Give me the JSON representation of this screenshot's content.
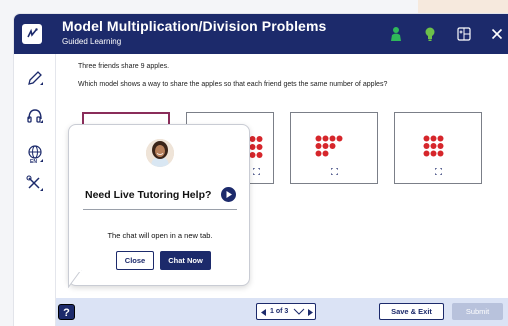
{
  "header": {
    "title": "Model Multiplication/Division Problems",
    "subtitle": "Guided Learning",
    "icons": [
      "logo-icon",
      "person-icon",
      "lightbulb-icon",
      "calculator-icon",
      "close-icon"
    ]
  },
  "sidebar": {
    "icons": [
      "pencil-tool-icon",
      "headphones-icon",
      "language-globe-icon",
      "tools-icon"
    ],
    "language_badge": "EN"
  },
  "question": {
    "line1": "Three friends share 9 apples.",
    "line2": "Which model shows a way to share the apples so that each friend gets the same number of apples?"
  },
  "popup": {
    "title": "Need Live Tutoring Help?",
    "note": "The chat will open in a new tab.",
    "close_label": "Close",
    "chat_label": "Chat Now"
  },
  "footer": {
    "help_label": "?",
    "pager_text": "1 of 3",
    "save_label": "Save & Exit",
    "submit_label": "Submit"
  },
  "colors": {
    "navy": "#1c2a6b",
    "apple_red": "#d6262b",
    "selected_border": "#8a2d5a",
    "footer_bg": "#dbe3f5",
    "person_green": "#2fb85a",
    "bulb_green": "#6cc04a"
  }
}
